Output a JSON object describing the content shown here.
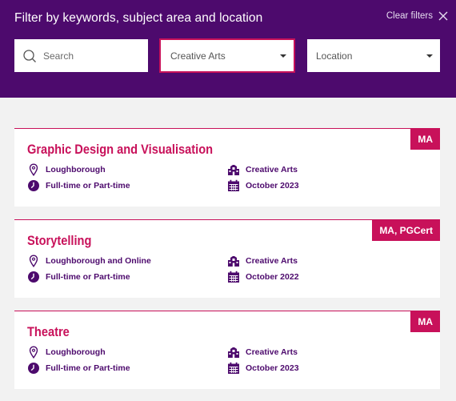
{
  "filters": {
    "title": "Filter by keywords, subject area and location",
    "clear_label": "Clear filters",
    "search_placeholder": "Search",
    "subject_value": "Creative Arts",
    "location_placeholder": "Location"
  },
  "courses": [
    {
      "title": "Graphic Design and Visualisation",
      "badge": "MA",
      "location": "Loughborough",
      "mode": "Full-time or Part-time",
      "subject": "Creative Arts",
      "start": "October 2023"
    },
    {
      "title": "Storytelling",
      "badge": "MA, PGCert",
      "location": "Loughborough and Online",
      "mode": "Full-time or Part-time",
      "subject": "Creative Arts",
      "start": "October 2022"
    },
    {
      "title": "Theatre",
      "badge": "MA",
      "location": "Loughborough",
      "mode": "Full-time or Part-time",
      "subject": "Creative Arts",
      "start": "October 2023"
    }
  ],
  "colors": {
    "header_bg": "#4d0a6d",
    "accent": "#c8115a",
    "text_purple": "#4d0a6d"
  },
  "icons": [
    "search-icon",
    "close-icon",
    "chevron-down-icon",
    "location-pin-icon",
    "clock-icon",
    "building-icon",
    "calendar-icon"
  ]
}
